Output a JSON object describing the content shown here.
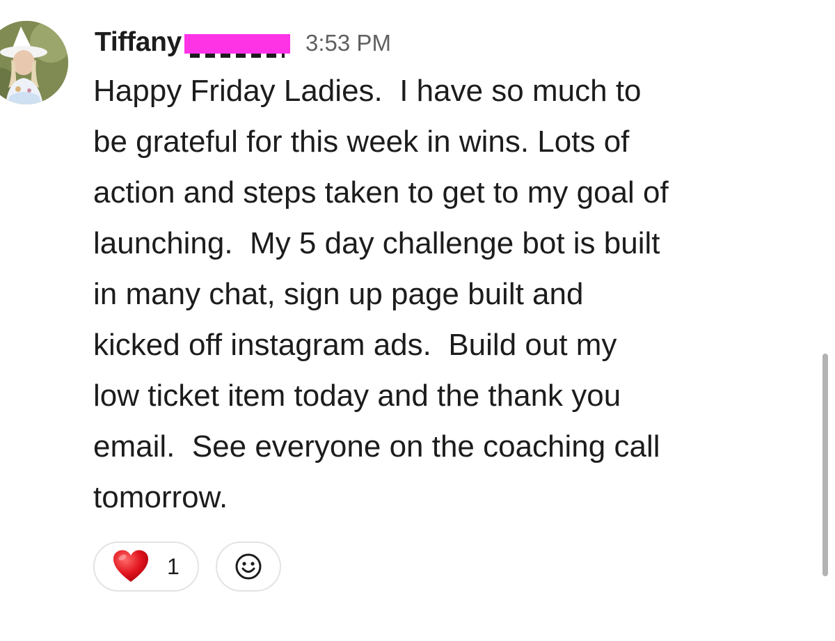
{
  "message": {
    "author": "Tiffany",
    "timestamp": "3:53 PM",
    "lines": [
      "Happy Friday Ladies.  I have so much to",
      "be grateful for this week in wins. Lots of",
      "action and steps taken to get to my goal of",
      "launching.  My 5 day challenge bot is built",
      "in many chat, sign up page built and",
      "kicked off instagram ads.  Build out my",
      "low ticket item today and the thank you",
      "email.  See everyone on the coaching call",
      "tomorrow."
    ],
    "reactions": [
      {
        "icon": "heart-icon",
        "count": "1"
      }
    ],
    "add_reaction_icon": "smiley-icon"
  },
  "colors": {
    "redaction": "#ff33e6",
    "heart": "#e0141e",
    "timestamp": "#616061",
    "text": "#1d1c1d"
  }
}
